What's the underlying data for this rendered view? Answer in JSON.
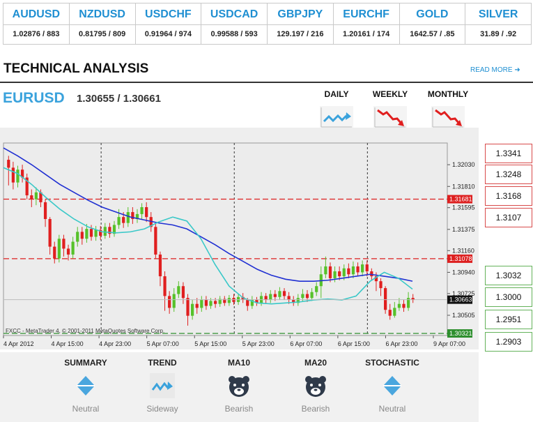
{
  "ticker": [
    {
      "symbol": "AUDUSD",
      "price": "1.02876 / 883"
    },
    {
      "symbol": "NZDUSD",
      "price": "0.81795 / 809"
    },
    {
      "symbol": "USDCHF",
      "price": "0.91964 / 974"
    },
    {
      "symbol": "USDCAD",
      "price": "0.99588 / 593"
    },
    {
      "symbol": "GBPJPY",
      "price": "129.197 / 216"
    },
    {
      "symbol": "EURCHF",
      "price": "1.20161 / 174"
    },
    {
      "symbol": "GOLD",
      "price": "1642.57 / .85"
    },
    {
      "symbol": "SILVER",
      "price": "31.89 / .92"
    }
  ],
  "section": {
    "title": "TECHNICAL ANALYSIS",
    "read_more": "READ MORE"
  },
  "pair": {
    "symbol": "EURUSD",
    "quote": "1.30655 / 1.30661"
  },
  "periods": [
    {
      "label": "DAILY",
      "icon": "sideways-trend-icon"
    },
    {
      "label": "WEEKLY",
      "icon": "bearish-trend-icon"
    },
    {
      "label": "MONTHLY",
      "icon": "bearish-trend-icon"
    }
  ],
  "levels": {
    "resistance": [
      "1.3341",
      "1.3248",
      "1.3168",
      "1.3107"
    ],
    "support": [
      "1.3032",
      "1.3000",
      "1.2951",
      "1.2903"
    ]
  },
  "chart_data": {
    "type": "candlestick",
    "y_ticks": [
      "1.32030",
      "1.31810",
      "1.31595",
      "1.31375",
      "1.31160",
      "1.30940",
      "1.30725",
      "1.30505"
    ],
    "x_ticks": [
      "4 Apr 2012",
      "4 Apr 15:00",
      "4 Apr 23:00",
      "5 Apr 07:00",
      "5 Apr 15:00",
      "5 Apr 23:00",
      "6 Apr 07:00",
      "6 Apr 15:00",
      "6 Apr 23:00",
      "9 Apr 07:00"
    ],
    "ylim": [
      1.303,
      1.3225
    ],
    "hlines": [
      {
        "label": "1.31681",
        "value": 1.31681,
        "color": "#dd1f1f"
      },
      {
        "label": "1.31078",
        "value": 1.31078,
        "color": "#dd1f1f"
      },
      {
        "label": "1.30321",
        "value": 1.30321,
        "color": "#2e8f2e"
      }
    ],
    "current": {
      "label": "1.30663",
      "value": 1.30663
    },
    "credit": "FXCC - MetaTrader 4, © 2001-2011 MetaQuotes Software Corp.",
    "session_breaks": [
      0.22,
      0.52,
      0.82
    ],
    "candles": [
      [
        1.3208,
        1.32,
        1.3212,
        1.3182
      ],
      [
        1.32,
        1.3185,
        1.3206,
        1.3178
      ],
      [
        1.3185,
        1.3198,
        1.3202,
        1.318
      ],
      [
        1.3198,
        1.319,
        1.3203,
        1.3185
      ],
      [
        1.319,
        1.3172,
        1.3194,
        1.3168
      ],
      [
        1.3172,
        1.3168,
        1.3178,
        1.316
      ],
      [
        1.3168,
        1.3175,
        1.318,
        1.3162
      ],
      [
        1.3175,
        1.3165,
        1.3178,
        1.316
      ],
      [
        1.3165,
        1.3148,
        1.3168,
        1.314
      ],
      [
        1.3148,
        1.312,
        1.315,
        1.3112
      ],
      [
        1.312,
        1.3108,
        1.3125,
        1.3103
      ],
      [
        1.3108,
        1.3128,
        1.3132,
        1.3104
      ],
      [
        1.3128,
        1.3118,
        1.3132,
        1.311
      ],
      [
        1.3118,
        1.3112,
        1.3122,
        1.3106
      ],
      [
        1.3112,
        1.3125,
        1.313,
        1.3108
      ],
      [
        1.3125,
        1.3135,
        1.314,
        1.312
      ],
      [
        1.3135,
        1.3128,
        1.314,
        1.3122
      ],
      [
        1.3128,
        1.3138,
        1.3143,
        1.3124
      ],
      [
        1.3138,
        1.313,
        1.3142,
        1.3126
      ],
      [
        1.313,
        1.3137,
        1.3141,
        1.3126
      ],
      [
        1.3137,
        1.3131,
        1.3141,
        1.3127
      ],
      [
        1.3131,
        1.314,
        1.3144,
        1.3128
      ],
      [
        1.314,
        1.3133,
        1.3144,
        1.3129
      ],
      [
        1.3133,
        1.3142,
        1.3146,
        1.313
      ],
      [
        1.3142,
        1.315,
        1.3158,
        1.3138
      ],
      [
        1.315,
        1.3144,
        1.3155,
        1.3139
      ],
      [
        1.3144,
        1.3155,
        1.316,
        1.314
      ],
      [
        1.3155,
        1.3148,
        1.316,
        1.3143
      ],
      [
        1.3148,
        1.3153,
        1.3158,
        1.3144
      ],
      [
        1.3153,
        1.316,
        1.3164,
        1.3148
      ],
      [
        1.316,
        1.315,
        1.3165,
        1.3145
      ],
      [
        1.315,
        1.314,
        1.3155,
        1.3135
      ],
      [
        1.314,
        1.3112,
        1.3143,
        1.3108
      ],
      [
        1.3112,
        1.309,
        1.3115,
        1.308
      ],
      [
        1.309,
        1.307,
        1.3095,
        1.3055
      ],
      [
        1.307,
        1.3058,
        1.3075,
        1.3052
      ],
      [
        1.3058,
        1.3072,
        1.3078,
        1.3054
      ],
      [
        1.3072,
        1.308,
        1.3085,
        1.3068
      ],
      [
        1.308,
        1.3068,
        1.3084,
        1.3062
      ],
      [
        1.3068,
        1.305,
        1.3072,
        1.304
      ],
      [
        1.305,
        1.3062,
        1.3066,
        1.3046
      ],
      [
        1.3062,
        1.3058,
        1.3068,
        1.3052
      ],
      [
        1.3058,
        1.3066,
        1.307,
        1.3054
      ],
      [
        1.3066,
        1.306,
        1.307,
        1.3056
      ],
      [
        1.306,
        1.3065,
        1.3068,
        1.3057
      ],
      [
        1.3065,
        1.3062,
        1.3068,
        1.3058
      ],
      [
        1.3062,
        1.3067,
        1.307,
        1.3059
      ],
      [
        1.3067,
        1.3063,
        1.307,
        1.306
      ],
      [
        1.3063,
        1.3068,
        1.3071,
        1.306
      ],
      [
        1.3068,
        1.3064,
        1.3072,
        1.3061
      ],
      [
        1.3064,
        1.3069,
        1.3072,
        1.3061
      ],
      [
        1.3069,
        1.3066,
        1.3073,
        1.3063
      ],
      [
        1.3066,
        1.306,
        1.3068,
        1.3055
      ],
      [
        1.306,
        1.3066,
        1.307,
        1.3057
      ],
      [
        1.3066,
        1.3063,
        1.3069,
        1.306
      ],
      [
        1.3063,
        1.307,
        1.3074,
        1.306
      ],
      [
        1.307,
        1.3066,
        1.3073,
        1.3062
      ],
      [
        1.3066,
        1.3072,
        1.3076,
        1.3063
      ],
      [
        1.3072,
        1.3069,
        1.3076,
        1.3065
      ],
      [
        1.3069,
        1.3075,
        1.3079,
        1.3066
      ],
      [
        1.3075,
        1.307,
        1.3078,
        1.3066
      ],
      [
        1.307,
        1.3066,
        1.3074,
        1.3062
      ],
      [
        1.3066,
        1.3063,
        1.307,
        1.306
      ],
      [
        1.3063,
        1.3068,
        1.3072,
        1.306
      ],
      [
        1.3068,
        1.3072,
        1.3077,
        1.3064
      ],
      [
        1.3072,
        1.3068,
        1.3076,
        1.3064
      ],
      [
        1.3068,
        1.3074,
        1.3078,
        1.3065
      ],
      [
        1.3074,
        1.308,
        1.3084,
        1.307
      ],
      [
        1.308,
        1.3092,
        1.31,
        1.3068
      ],
      [
        1.3092,
        1.31,
        1.311,
        1.3088
      ],
      [
        1.31,
        1.3088,
        1.3104,
        1.3084
      ],
      [
        1.3088,
        1.3095,
        1.31,
        1.3084
      ],
      [
        1.3095,
        1.309,
        1.31,
        1.3086
      ],
      [
        1.309,
        1.3098,
        1.3102,
        1.3086
      ],
      [
        1.3098,
        1.3092,
        1.3103,
        1.3088
      ],
      [
        1.3092,
        1.31,
        1.3105,
        1.3088
      ],
      [
        1.31,
        1.3094,
        1.3104,
        1.309
      ],
      [
        1.3094,
        1.3102,
        1.3106,
        1.309
      ],
      [
        1.3102,
        1.3095,
        1.3106,
        1.309
      ],
      [
        1.3095,
        1.309,
        1.3098,
        1.3086
      ],
      [
        1.309,
        1.3085,
        1.3094,
        1.3075
      ],
      [
        1.3085,
        1.3078,
        1.3088,
        1.307
      ],
      [
        1.3078,
        1.3056,
        1.308,
        1.3052
      ],
      [
        1.3056,
        1.305,
        1.3062,
        1.3046
      ],
      [
        1.305,
        1.3058,
        1.3064,
        1.3048
      ],
      [
        1.3058,
        1.3062,
        1.3068,
        1.3055
      ],
      [
        1.3062,
        1.3058,
        1.3066,
        1.3054
      ],
      [
        1.3058,
        1.3068,
        1.3074,
        1.3055
      ],
      [
        1.3068,
        1.3066,
        1.3072,
        1.3063
      ]
    ],
    "ma20": [
      1.322,
      1.3212,
      1.3203,
      1.3193,
      1.3183,
      1.3175,
      1.3167,
      1.316,
      1.3155,
      1.315,
      1.3147,
      1.3144,
      1.3142,
      1.3138,
      1.313,
      1.3122,
      1.3113,
      1.3105,
      1.3097,
      1.3091,
      1.3087,
      1.3085,
      1.3085,
      1.3086,
      1.3088,
      1.309,
      1.3092,
      1.309,
      1.3088,
      1.3085
    ],
    "ma10": [
      1.32,
      1.3194,
      1.3183,
      1.317,
      1.3158,
      1.3148,
      1.314,
      1.3135,
      1.3134,
      1.3135,
      1.3138,
      1.3145,
      1.315,
      1.3146,
      1.3128,
      1.3102,
      1.308,
      1.3068,
      1.3063,
      1.3062,
      1.3063,
      1.3064,
      1.3066,
      1.3067,
      1.3066,
      1.307,
      1.3085,
      1.3094,
      1.3088,
      1.3077
    ]
  },
  "indicators": [
    {
      "title": "SUMMARY",
      "value": "Neutral",
      "icon": "neutral-diamond-icon"
    },
    {
      "title": "TREND",
      "value": "Sideway",
      "icon": "sideways-trend-icon"
    },
    {
      "title": "MA10",
      "value": "Bearish",
      "icon": "bear-icon"
    },
    {
      "title": "MA20",
      "value": "Bearish",
      "icon": "bear-icon"
    },
    {
      "title": "STOCHASTIC",
      "value": "Neutral",
      "icon": "neutral-diamond-icon"
    }
  ],
  "colors": {
    "accent": "#1f8fd2",
    "bull": "#56c12a",
    "bear": "#e01f1f",
    "ma10": "#39c8c8",
    "ma20": "#1f2fd2"
  }
}
